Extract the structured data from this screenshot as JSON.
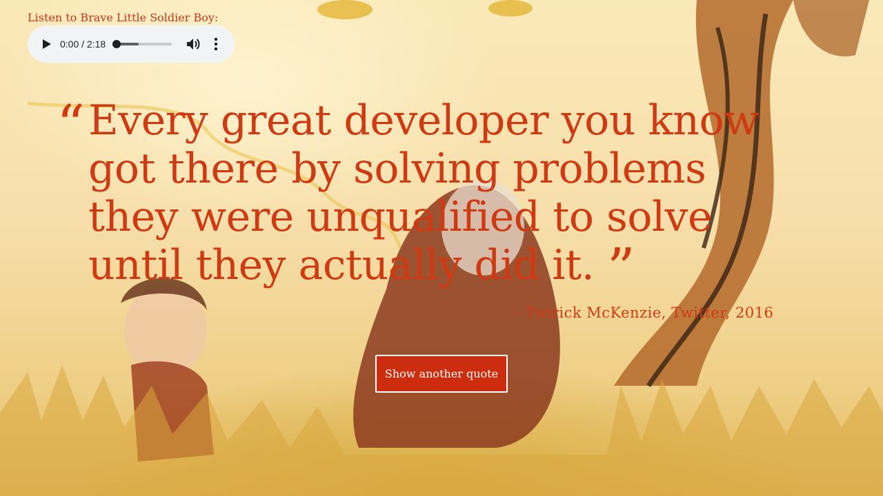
{
  "audio": {
    "label": "Listen to Brave Little Soldier Boy:",
    "current_time": "0:00",
    "duration": "2:18",
    "time_display": "0:00 / 2:18",
    "progress": 0.0,
    "buffered": 0.4
  },
  "quote": {
    "open_mark": "“",
    "text": "Every great developer you know got there by solving problems they were unqualified to solve until they actually did it.",
    "close_mark": "”",
    "attribution": "– Patrick McKenzie, Twitter, 2016"
  },
  "actions": {
    "another_quote_label": "Show another quote"
  },
  "icons": {
    "play": "play-icon",
    "volume": "volume-icon",
    "more": "more-vertical-icon"
  },
  "colors": {
    "accent": "#cf3a12",
    "button": "#cc2d0f",
    "player_bg": "#f1f3f4",
    "background": "#f6dfa2"
  }
}
